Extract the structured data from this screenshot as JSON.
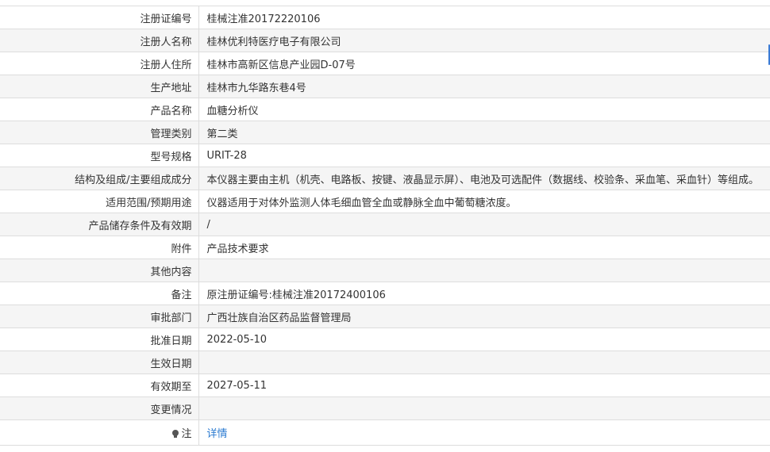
{
  "rows": [
    {
      "label": "注册证编号",
      "value": "桂械注准20172220106"
    },
    {
      "label": "注册人名称",
      "value": "桂林优利特医疗电子有限公司"
    },
    {
      "label": "注册人住所",
      "value": "桂林市高新区信息产业园D-07号"
    },
    {
      "label": "生产地址",
      "value": "桂林市九华路东巷4号"
    },
    {
      "label": "产品名称",
      "value": "血糖分析仪"
    },
    {
      "label": "管理类别",
      "value": "第二类"
    },
    {
      "label": "型号规格",
      "value": "URIT-28"
    },
    {
      "label": "结构及组成/主要组成成分",
      "value": "本仪器主要由主机（机壳、电路板、按键、液晶显示屏）、电池及可选配件（数据线、校验条、采血笔、采血针）等组成。"
    },
    {
      "label": "适用范围/预期用途",
      "value": "仪器适用于对体外监测人体毛细血管全血或静脉全血中葡萄糖浓度。"
    },
    {
      "label": "产品储存条件及有效期",
      "value": "/"
    },
    {
      "label": "附件",
      "value": "产品技术要求"
    },
    {
      "label": "其他内容",
      "value": ""
    },
    {
      "label": "备注",
      "value": "原注册证编号:桂械注准20172400106"
    },
    {
      "label": "审批部门",
      "value": "广西壮族自治区药品监督管理局"
    },
    {
      "label": "批准日期",
      "value": "2022-05-10"
    },
    {
      "label": "生效日期",
      "value": ""
    },
    {
      "label": "有效期至",
      "value": "2027-05-11"
    },
    {
      "label": "变更情况",
      "value": ""
    }
  ],
  "note": {
    "icon": "lightbulb-icon",
    "label": "注",
    "link_text": "详情"
  },
  "colors": {
    "link": "#2b7bd1",
    "stripe": "#f5f5f5",
    "border": "#dddddd",
    "text": "#333333"
  }
}
